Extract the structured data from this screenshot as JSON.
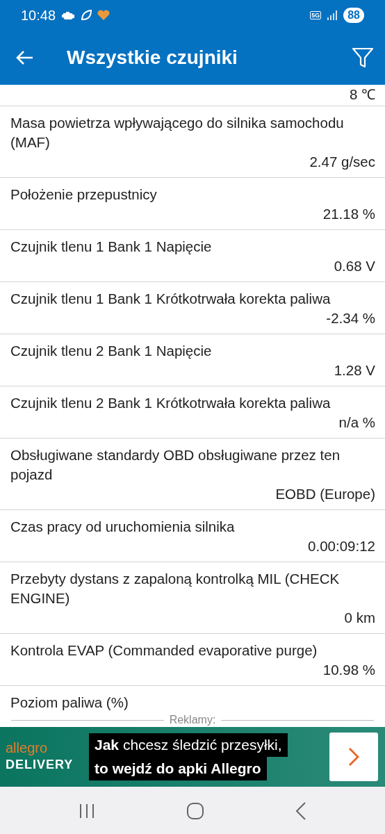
{
  "status_bar": {
    "time": "10:48",
    "network": "5G",
    "battery": "88"
  },
  "app_bar": {
    "title": "Wszystkie czujniki"
  },
  "sensors": [
    {
      "value": "8 ℃"
    },
    {
      "name": "Masa powietrza wpływającego do silnika samochodu (MAF)",
      "value": "2.47 g/sec"
    },
    {
      "name": "Położenie przepustnicy",
      "value": "21.18 %"
    },
    {
      "name": "Czujnik tlenu 1 Bank 1 Napięcie",
      "value": "0.68 V"
    },
    {
      "name": "Czujnik tlenu 1 Bank 1 Krótkotrwała korekta paliwa",
      "value": "-2.34 %"
    },
    {
      "name": "Czujnik tlenu 2 Bank 1 Napięcie",
      "value": "1.28 V"
    },
    {
      "name": "Czujnik tlenu 2 Bank 1 Krótkotrwała korekta paliwa",
      "value": "n/a %"
    },
    {
      "name": "Obsługiwane standardy OBD obsługiwane przez ten pojazd",
      "value": "EOBD (Europe)"
    },
    {
      "name": "Czas pracy od uruchomienia silnika",
      "value": "0.00:09:12"
    },
    {
      "name": "Przebyty dystans z zapaloną kontrolką MIL (CHECK ENGINE)",
      "value": "0 km"
    },
    {
      "name": "Kontrola EVAP (Commanded evaporative purge)",
      "value": "10.98 %"
    },
    {
      "name": "Poziom paliwa (%)"
    }
  ],
  "ads": {
    "label": "Reklamy:",
    "brand": "allegro",
    "brand_sub": "DELIVERY",
    "line_1": "**Jak** chcesz śledzić przesyłki,",
    "line_2": "to wejdź do apki Allegro"
  }
}
